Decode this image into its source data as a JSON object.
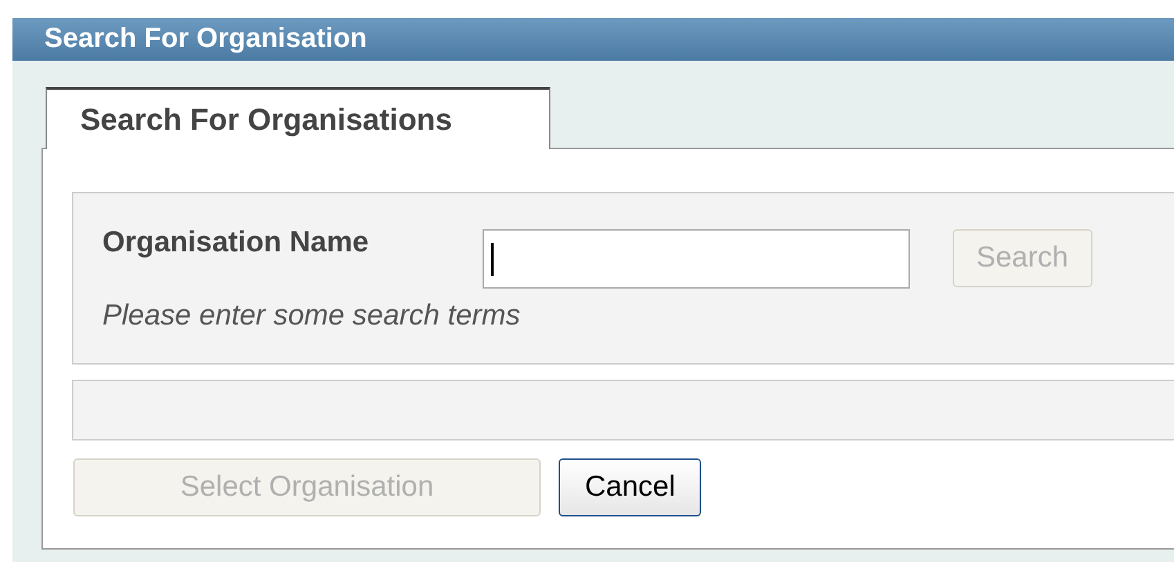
{
  "window": {
    "title": "Search For Organisation"
  },
  "tabs": [
    {
      "label": "Search For Organisations",
      "selected": true
    }
  ],
  "search": {
    "label": "Organisation Name",
    "focused": true,
    "button": {
      "label": "Search",
      "disabled": true
    },
    "hint": "Please enter some search terms"
  },
  "buttons": [
    {
      "label": "Select Organisation",
      "disabled": true
    },
    {
      "label": "Cancel",
      "disabled": false
    }
  ]
}
